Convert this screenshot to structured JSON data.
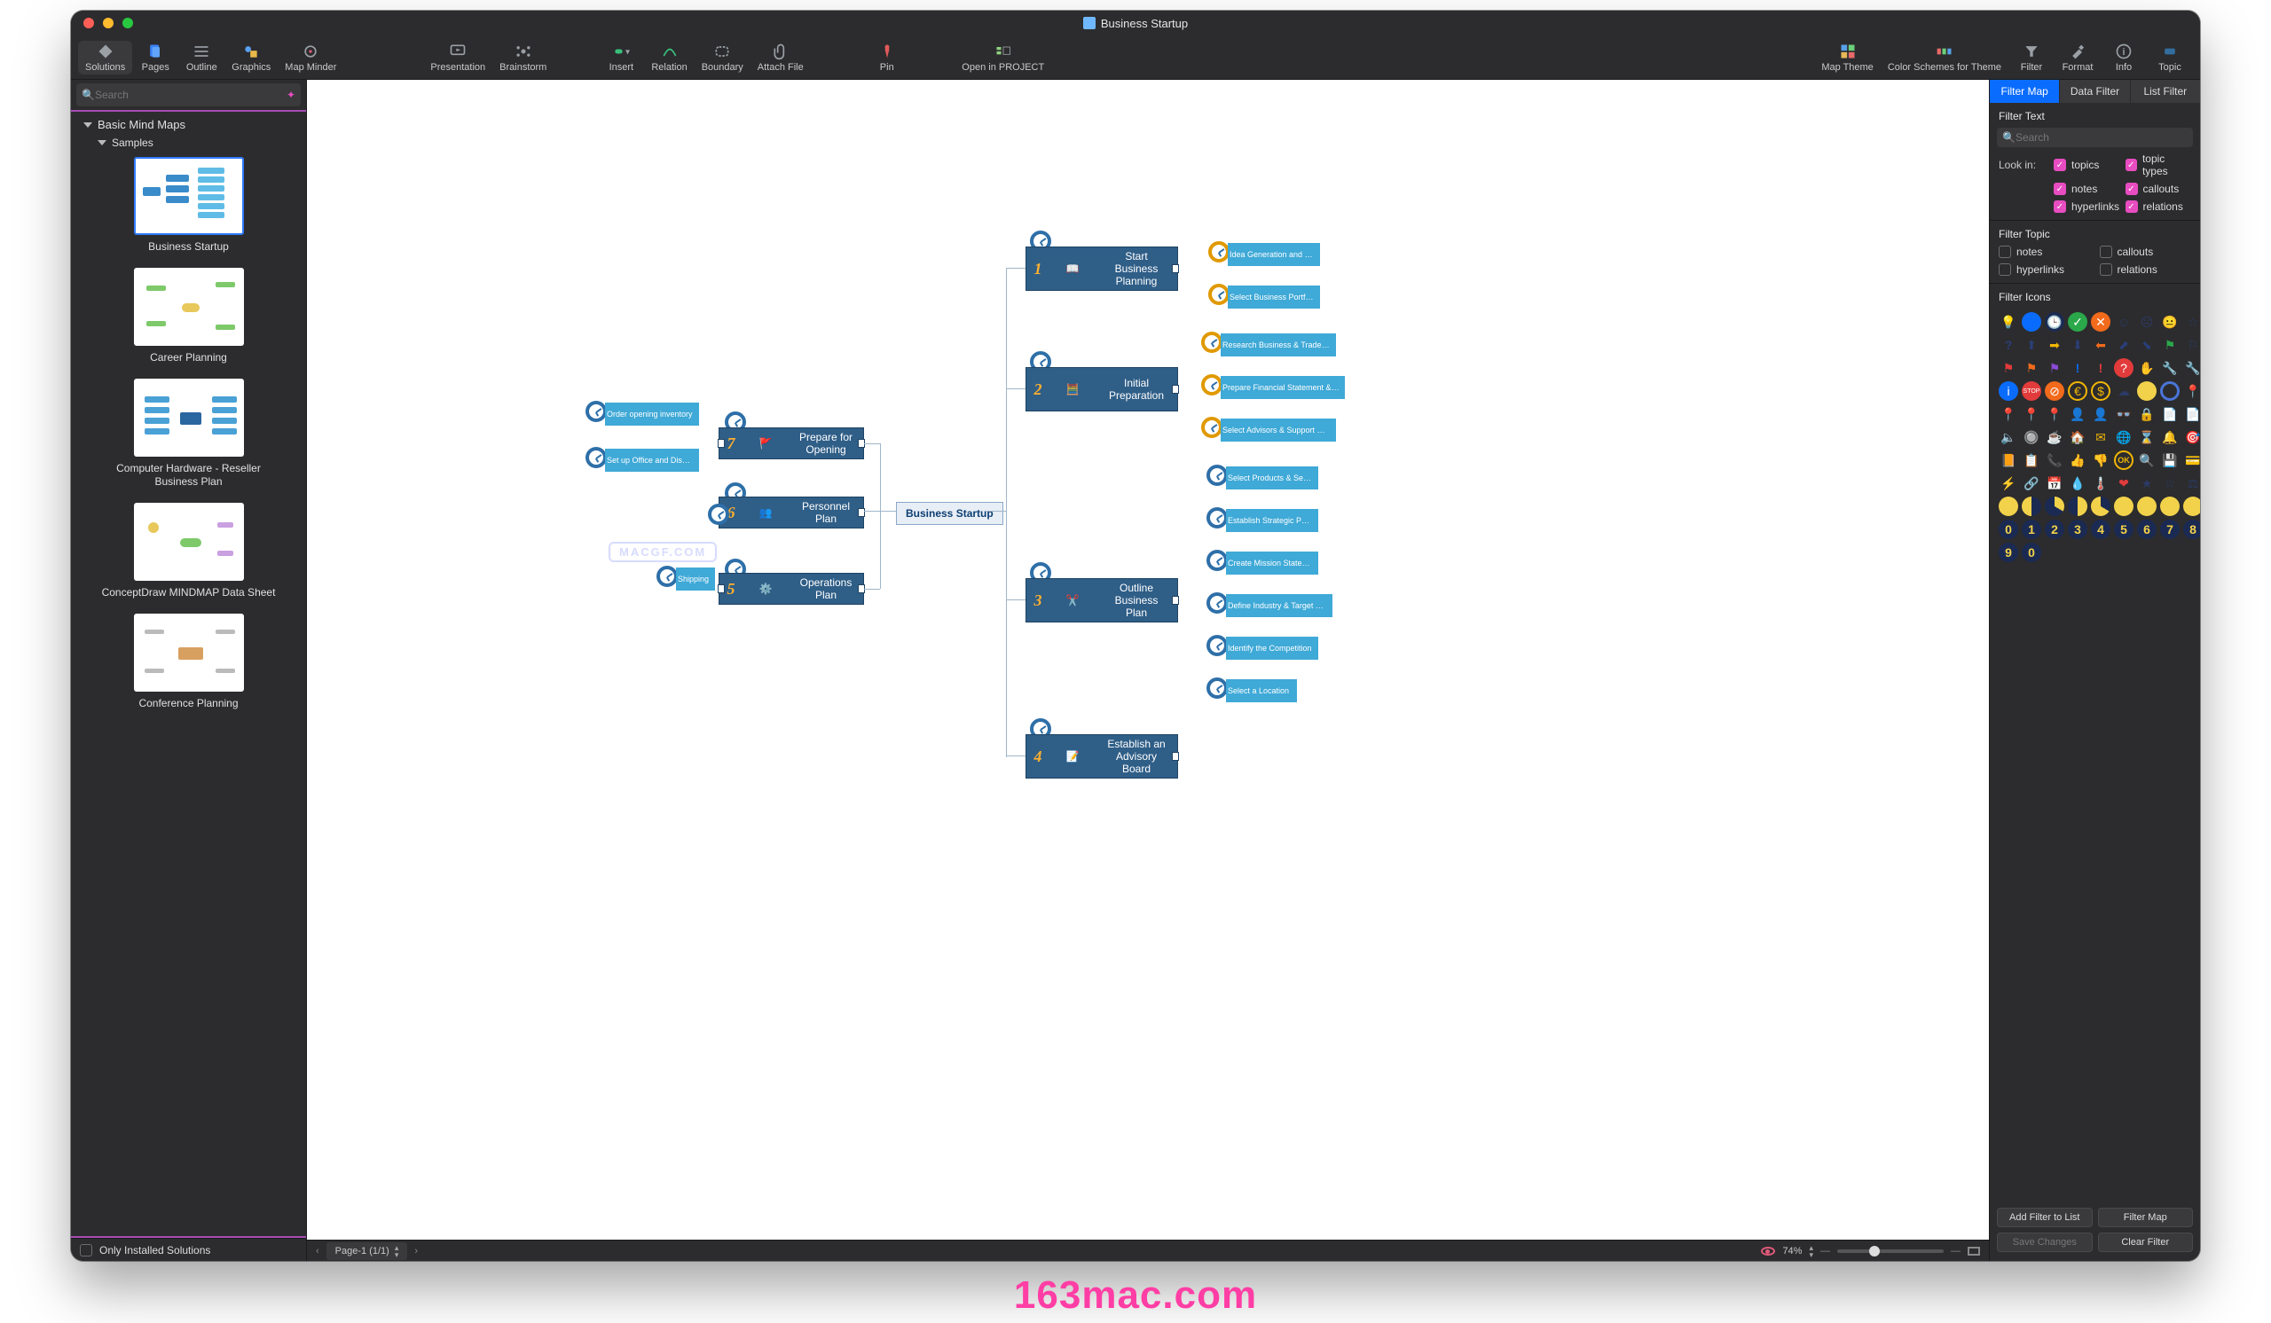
{
  "title": "Business Startup",
  "toolbar": {
    "solutions": "Solutions",
    "pages": "Pages",
    "outline": "Outline",
    "graphics": "Graphics",
    "mapMinder": "Map Minder",
    "presentation": "Presentation",
    "brainstorm": "Brainstorm",
    "insert": "Insert",
    "relation": "Relation",
    "boundary": "Boundary",
    "attachFile": "Attach File",
    "pin": "Pin",
    "openInProject": "Open in PROJECT",
    "mapTheme": "Map Theme",
    "colorSchemes": "Color Schemes for Theme",
    "filter": "Filter",
    "format": "Format",
    "info": "Info",
    "topic": "Topic"
  },
  "sidebar": {
    "searchPlaceholder": "Search",
    "root": "Basic Mind Maps",
    "group": "Samples",
    "items": [
      {
        "label": "Business Startup"
      },
      {
        "label": "Career Planning"
      },
      {
        "label": "Computer Hardware - Reseller Business Plan"
      },
      {
        "label": "ConceptDraw MINDMAP Data Sheet"
      },
      {
        "label": "Conference Planning"
      }
    ],
    "onlyInstalled": "Only Installed Solutions"
  },
  "canvas": {
    "center": "Business Startup",
    "watermark": "MACGF.COM",
    "left": {
      "prepare": "Prepare for Opening",
      "prepareNum": "7",
      "prepareSub1": "Order opening inventory",
      "prepareSub2": "Set up Office and Display Areas",
      "personnel": "Personnel Plan",
      "personnelNum": "6",
      "operations": "Operations Plan",
      "operationsNum": "5",
      "shipping": "Shipping"
    },
    "right": {
      "n1": {
        "num": "1",
        "label": "Start Business Planning",
        "subs": [
          "Idea Generation and Refining",
          "Select Business Portfolio"
        ]
      },
      "n2": {
        "num": "2",
        "label": "Initial Preparation",
        "subs": [
          "Research Business & Trade Organizations",
          "Prepare Financial Statement & Balance Sheet",
          "Select Advisors & Support Consultants"
        ]
      },
      "n3": {
        "num": "3",
        "label": "Outline Business Plan",
        "subs": [
          "Select Products & Services",
          "Establish Strategic Position",
          "Create Mission Statement",
          "Define Industry & Target Markets",
          "Identify the Competition",
          "Select a Location"
        ]
      },
      "n4": {
        "num": "4",
        "label": "Establish an Advisory Board"
      }
    }
  },
  "status": {
    "page": "Page-1 (1/1)",
    "zoom": "74%"
  },
  "inspector": {
    "tabs": [
      "Filter Map",
      "Data Filter",
      "List Filter"
    ],
    "section1": "Filter Text",
    "searchPlaceholder": "Search",
    "lookIn": "Look in:",
    "lookItems": [
      "topics",
      "topic types",
      "notes",
      "callouts",
      "hyperlinks",
      "relations"
    ],
    "section2": "Filter Topic",
    "topicItems": [
      "notes",
      "callouts",
      "hyperlinks",
      "relations"
    ],
    "section3": "Filter Icons",
    "buttons": {
      "addFilter": "Add Filter to List",
      "filterMap": "Filter Map",
      "saveChanges": "Save Changes",
      "clearFilter": "Clear Filter"
    }
  },
  "brand": "163mac.com"
}
